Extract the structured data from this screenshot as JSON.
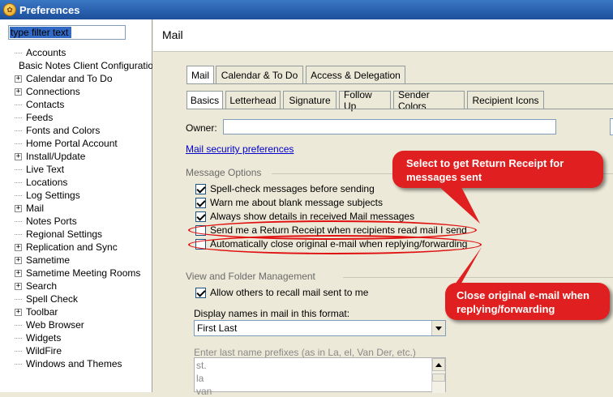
{
  "window": {
    "title": "Preferences"
  },
  "filter": {
    "placeholder": "type filter text"
  },
  "tree": [
    {
      "label": "Accounts",
      "expandable": false
    },
    {
      "label": "Basic Notes Client Configuration",
      "expandable": false
    },
    {
      "label": "Calendar and To Do",
      "expandable": true
    },
    {
      "label": "Connections",
      "expandable": true
    },
    {
      "label": "Contacts",
      "expandable": false
    },
    {
      "label": "Feeds",
      "expandable": false
    },
    {
      "label": "Fonts and Colors",
      "expandable": false
    },
    {
      "label": "Home Portal Account",
      "expandable": false
    },
    {
      "label": "Install/Update",
      "expandable": true
    },
    {
      "label": "Live Text",
      "expandable": false
    },
    {
      "label": "Locations",
      "expandable": false
    },
    {
      "label": "Log Settings",
      "expandable": false
    },
    {
      "label": "Mail",
      "expandable": true
    },
    {
      "label": "Notes Ports",
      "expandable": false
    },
    {
      "label": "Regional Settings",
      "expandable": false
    },
    {
      "label": "Replication and Sync",
      "expandable": true
    },
    {
      "label": "Sametime",
      "expandable": true
    },
    {
      "label": "Sametime Meeting Rooms",
      "expandable": true
    },
    {
      "label": "Search",
      "expandable": true
    },
    {
      "label": "Spell Check",
      "expandable": false
    },
    {
      "label": "Toolbar",
      "expandable": true
    },
    {
      "label": "Web Browser",
      "expandable": false
    },
    {
      "label": "Widgets",
      "expandable": false
    },
    {
      "label": "WildFire",
      "expandable": false
    },
    {
      "label": "Windows and Themes",
      "expandable": false
    }
  ],
  "page": {
    "title": "Mail"
  },
  "tabs_top": [
    "Mail",
    "Calendar & To Do",
    "Access & Delegation"
  ],
  "tabs_sub": [
    "Basics",
    "Letterhead",
    "Signature",
    "Follow Up",
    "Sender Colors",
    "Recipient Icons"
  ],
  "owner": {
    "label": "Owner:",
    "value": ""
  },
  "security_link": "Mail security preferences",
  "message_options": {
    "title": "Message Options",
    "items": [
      {
        "label": "Spell-check messages before sending",
        "checked": true
      },
      {
        "label": "Warn me about blank message subjects",
        "checked": true
      },
      {
        "label": "Always show details in received Mail messages",
        "checked": true
      },
      {
        "label": "Send me a Return Receipt when recipients read mail I send",
        "checked": false
      },
      {
        "label": "Automatically close original e-mail when replying/forwarding",
        "checked": false
      }
    ]
  },
  "view_folder": {
    "title": "View and Folder Management",
    "recall_label": "Allow others to recall mail sent to me",
    "recall_checked": true,
    "display_label": "Display names in mail in this format:",
    "display_value": "First Last",
    "prefix_label": "Enter last name prefixes (as in La, el, Van Der, etc.)",
    "prefixes": [
      "st.",
      "la",
      "van"
    ]
  },
  "callouts": {
    "receipt": "Select to get Return Receipt for messages sent",
    "close": "Close original e-mail when replying/forwarding"
  },
  "colors": {
    "callout": "#e02020",
    "title_bar": "#2a63b4",
    "link": "#0000cc"
  }
}
